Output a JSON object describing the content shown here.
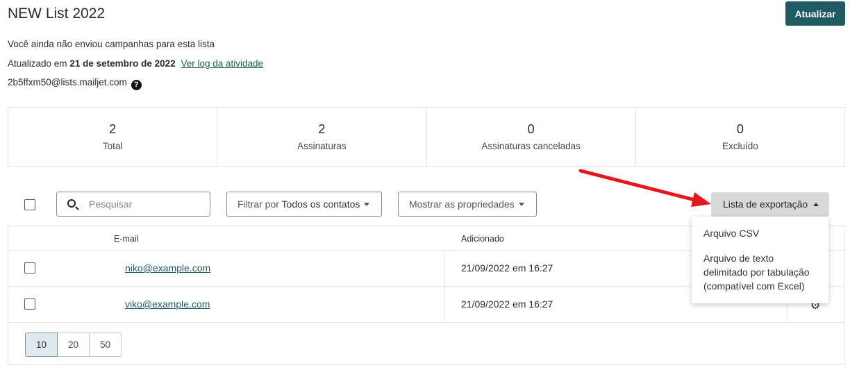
{
  "header": {
    "title": "NEW List 2022",
    "update_label": "Atualizar"
  },
  "info": {
    "no_campaigns": "Você ainda não enviou campanhas para esta lista",
    "updated_prefix": "Atualizado em",
    "updated_date": "21 de setembro de 2022",
    "activity_log_link": "Ver log da atividade",
    "list_email": "2b5ffxm50@lists.mailjet.com",
    "help_icon": "question-circle-icon"
  },
  "stats": [
    {
      "value": "2",
      "label": "Total"
    },
    {
      "value": "2",
      "label": "Assinaturas"
    },
    {
      "value": "0",
      "label": "Assinaturas canceladas"
    },
    {
      "value": "0",
      "label": "Excluído"
    }
  ],
  "toolbar": {
    "search_placeholder": "Pesquisar",
    "filter_prefix": "Filtrar por",
    "filter_value": "Todos os contatos",
    "properties_label": "Mostrar as propriedades",
    "export_label": "Lista de exportação"
  },
  "export_menu": {
    "items": [
      "Arquivo CSV",
      "Arquivo de texto delimitado por tabulação (compatível com Excel)"
    ],
    "item2_lines": [
      "Arquivo de texto",
      "delimitado por tabulação",
      "(compatível com Excel)"
    ]
  },
  "table": {
    "columns": [
      "E-mail",
      "Adicionado"
    ],
    "rows": [
      {
        "email": "niko@example.com",
        "added": "21/09/2022 em 16:27"
      },
      {
        "email": "viko@example.com",
        "added": "21/09/2022 em 16:27"
      }
    ]
  },
  "pagination": {
    "options": [
      "10",
      "20",
      "50"
    ],
    "selected": "10"
  },
  "colors": {
    "accent": "#1e5b62",
    "annotation_arrow": "#e8161b"
  }
}
